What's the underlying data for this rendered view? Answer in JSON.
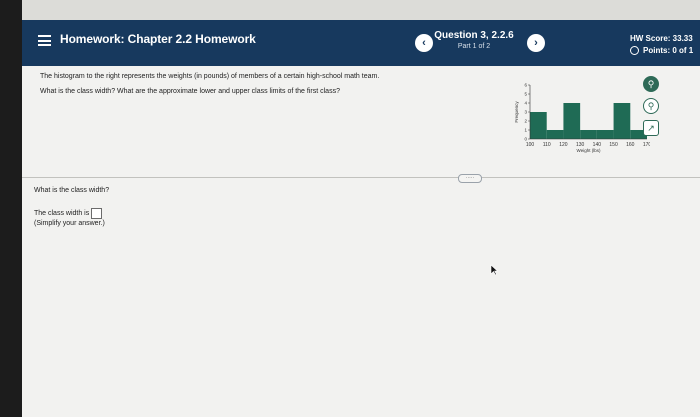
{
  "header": {
    "title": "Homework: Chapter 2.2 Homework",
    "question_title": "Question 3, 2.2.6",
    "question_part": "Part 1 of 2",
    "score": "HW Score: 33.33",
    "points": "Points: 0 of 1"
  },
  "question": {
    "line1": "The histogram to the right represents the weights (in pounds) of members of a certain high-school math team.",
    "line2": "What is the class width? What are the approximate lower and upper class limits of the first class?"
  },
  "answer": {
    "prompt": "What is the class width?",
    "label": "The class width is",
    "hint": "(Simplify your answer.)"
  },
  "more_button": "·····",
  "colors": {
    "header": "#17395e",
    "bar": "#1f6b55",
    "background": "#f2f2f0"
  },
  "icons": [
    "menu-icon",
    "chevron-left-icon",
    "chevron-right-icon",
    "zoom-in-icon",
    "zoom-out-icon",
    "external-link-icon",
    "cursor-icon"
  ],
  "chart_data": {
    "type": "bar",
    "xlabel": "Weight (lbs)",
    "ylabel": "Frequency",
    "x_ticks": [
      100,
      110,
      120,
      130,
      140,
      150,
      160,
      170
    ],
    "y_ticks": [
      0,
      1,
      2,
      3,
      4,
      5,
      6
    ],
    "bins": [
      {
        "from": 100,
        "to": 110,
        "value": 3
      },
      {
        "from": 110,
        "to": 120,
        "value": 1
      },
      {
        "from": 120,
        "to": 130,
        "value": 4
      },
      {
        "from": 130,
        "to": 140,
        "value": 1
      },
      {
        "from": 140,
        "to": 150,
        "value": 1
      },
      {
        "from": 150,
        "to": 160,
        "value": 4
      },
      {
        "from": 160,
        "to": 170,
        "value": 1
      }
    ],
    "xlim": [
      100,
      170
    ],
    "ylim": [
      0,
      6
    ]
  }
}
